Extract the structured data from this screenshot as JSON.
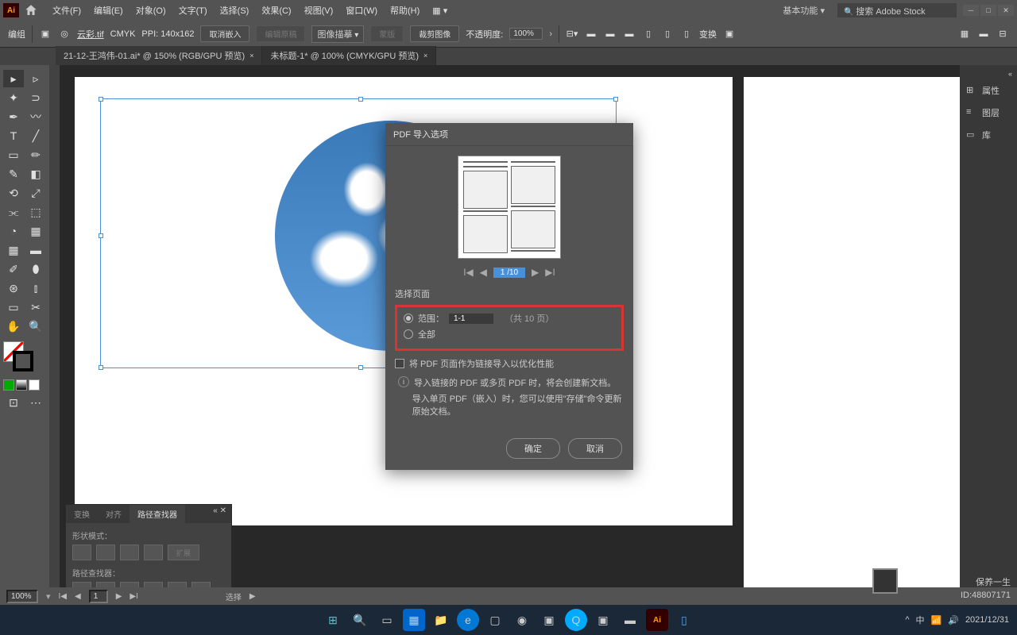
{
  "menubar": {
    "items": [
      "文件(F)",
      "编辑(E)",
      "对象(O)",
      "文字(T)",
      "选择(S)",
      "效果(C)",
      "视图(V)",
      "窗口(W)",
      "帮助(H)"
    ]
  },
  "workspace": {
    "label": "基本功能",
    "search_placeholder": "搜索 Adobe Stock"
  },
  "controlbar": {
    "group_label": "编组",
    "filename": "云彩.tif",
    "colormode": "CMYK",
    "ppi": "PPI: 140x162",
    "cancel_embed": "取消嵌入",
    "edit_original": "编辑原稿",
    "image_desc": "图像描摹",
    "mask": "蒙版",
    "crop": "裁剪图像",
    "opacity_label": "不透明度:",
    "opacity_value": "100%",
    "transform": "变换"
  },
  "tabs": [
    {
      "label": "21-12-王鸿伟-01.ai* @ 150% (RGB/GPU 预览)",
      "active": false
    },
    {
      "label": "未标题-1* @ 100% (CMYK/GPU 预览)",
      "active": true
    }
  ],
  "right_panels": {
    "items": [
      "属性",
      "图层",
      "库"
    ]
  },
  "dialog": {
    "title": "PDF 导入选项",
    "page_indicator": "1 /10",
    "section_label": "选择页面",
    "range_label": "范围：",
    "range_value": "1-1",
    "total_pages": "（共 10 页）",
    "all_label": "全部",
    "link_checkbox": "将 PDF 页面作为链接导入以优化性能",
    "info1": "导入链接的 PDF 或多页 PDF 时，将会创建新文档。",
    "info2": "导入单页 PDF（嵌入）时，您可以使用\"存储\"命令更新原始文档。",
    "ok": "确定",
    "cancel": "取消"
  },
  "pathfinder": {
    "tabs": [
      "变换",
      "对齐",
      "路径查找器"
    ],
    "shape_mode": "形状模式：",
    "expand": "扩展",
    "pathfinder_label": "路径查找器："
  },
  "statusbar": {
    "zoom": "100%",
    "page": "1",
    "select": "选择"
  },
  "watermark": {
    "line1": "保养一生",
    "line2": "ID:48807171"
  },
  "taskbar_date": "2021/12/31"
}
